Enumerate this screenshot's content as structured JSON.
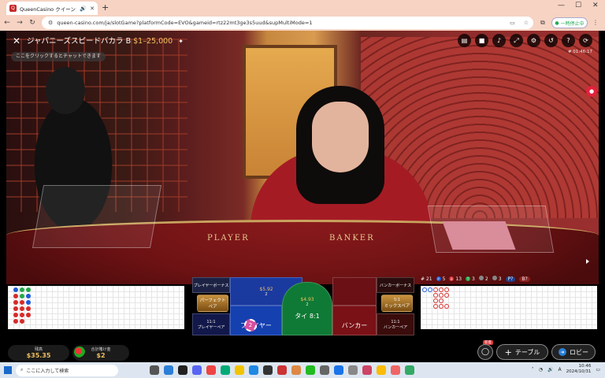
{
  "browser": {
    "tab_title": "QueenCasino クイーンカジノ |",
    "url": "queen-casino.com/ja/slotGame?platformCode=EVO&gameid=rtz22mt3ge3s5uud&supMultiMode=1",
    "pause_label": "一時停止中",
    "new_tab": "+"
  },
  "game": {
    "title": "ジャパニーズスピードバカラ B",
    "limit": "$1–25,000",
    "chat_hint": "ここをクリックするとチャットできます",
    "game_id": "# 01:46:17",
    "table_player": "PLAYER",
    "table_banker": "BANKER"
  },
  "stats": {
    "round": "# 21",
    "player_count": "5",
    "banker_count": "13",
    "tie_count": "3",
    "p_pair_count": "2",
    "b_pair_count": "3",
    "p_label": "P?",
    "b_label": "B?"
  },
  "bets": {
    "player_bonus": "プレイヤーボーナス",
    "banker_bonus": "バンカーボーナス",
    "perfect_pair": "パーフェクトペア",
    "mix_pair": "ミックスペア",
    "mix_odds": "5:1",
    "player_pair": "プレイヤーペア",
    "player_pair_odds": "11:1",
    "banker_pair": "バンカーペア",
    "banker_pair_odds": "11:1",
    "player": "プレイヤー",
    "player_amount": "$5.92",
    "player_count": "2",
    "tie": "タイ 8:1",
    "tie_amount": "$4.93",
    "tie_count": "2",
    "banker": "バンカー",
    "chip_value": "2"
  },
  "wallet": {
    "balance_label": "残高",
    "balance_value": "$35.35",
    "total_bet_label": "合計賭け金",
    "total_bet_value": "$2"
  },
  "buttons": {
    "new_badge": "新着",
    "table": "テーブル",
    "lobby": "ロビー"
  },
  "taskbar": {
    "search_placeholder": "ここに入力して検索",
    "time": "10:46",
    "date": "2024/10/31",
    "ime": "A"
  },
  "colors": {
    "player": "#1e5bd6",
    "banker": "#d62a2a",
    "tie": "#23a84a",
    "gold": "#f0c060"
  }
}
